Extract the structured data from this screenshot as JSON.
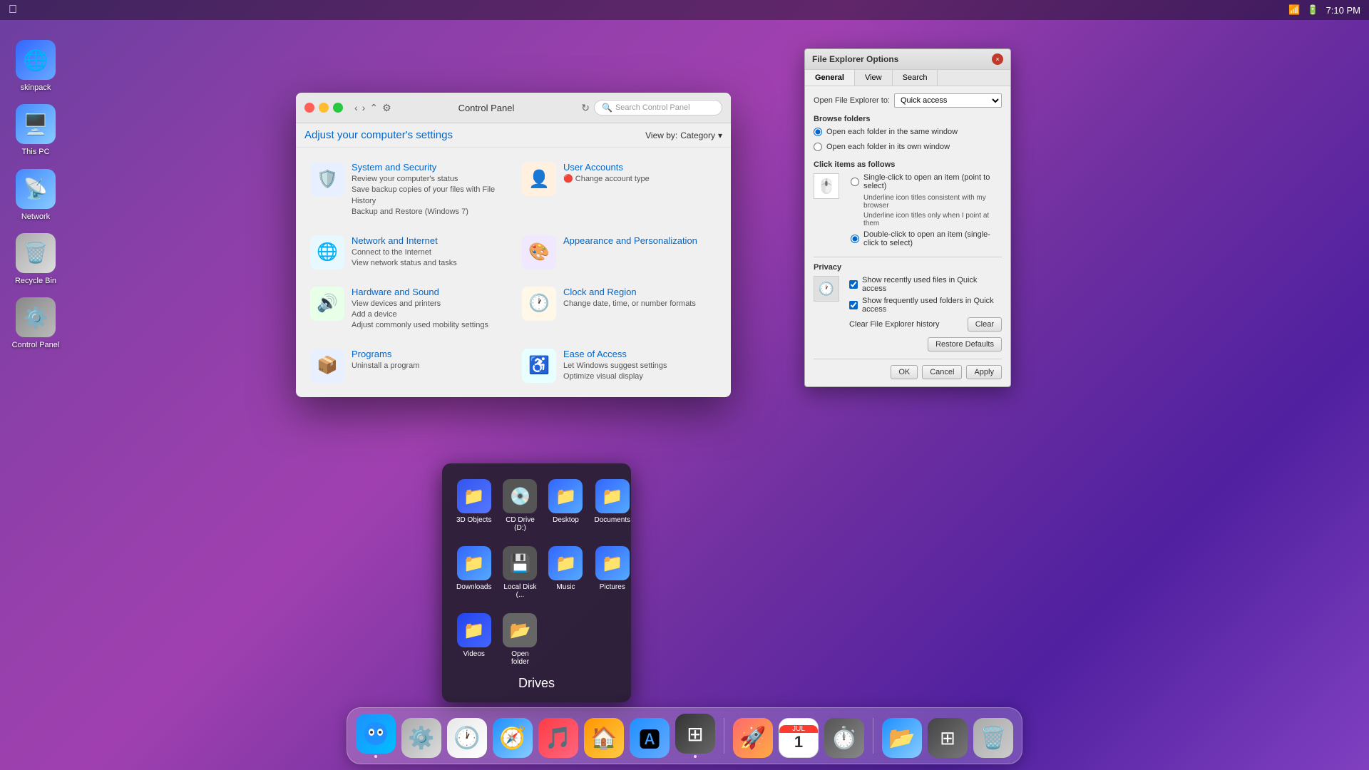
{
  "menubar": {
    "time": "7:10 PM",
    "wifi_icon": "📶",
    "battery_icon": "🔋"
  },
  "desktop": {
    "icons": [
      {
        "id": "skinpack",
        "label": "skinpack",
        "emoji": "🌐",
        "color": "#4488ff"
      },
      {
        "id": "this-pc",
        "label": "This PC",
        "emoji": "🖥️",
        "color": "#5599ff"
      },
      {
        "id": "network",
        "label": "Network",
        "emoji": "📡",
        "color": "#4488ff"
      },
      {
        "id": "recycle-bin",
        "label": "Recycle Bin",
        "emoji": "🗑️",
        "color": "#888"
      },
      {
        "id": "control-panel",
        "label": "Control Panel",
        "emoji": "⚙️",
        "color": "#888"
      }
    ]
  },
  "control_panel": {
    "title": "Control Panel",
    "heading": "Adjust your computer's settings",
    "view_by_label": "View by:",
    "view_by_value": "Category",
    "search_placeholder": "Search Control Panel",
    "items": [
      {
        "id": "system-security",
        "name": "System and Security",
        "description": "Review your computer's status\nSave backup copies of your files with File History\nBackup and Restore (Windows 7)",
        "emoji": "🛡️",
        "color": "#e8f0ff"
      },
      {
        "id": "user-accounts",
        "name": "User Accounts",
        "description": "Change account type",
        "emoji": "👤",
        "color": "#fff0e0"
      },
      {
        "id": "network-internet",
        "name": "Network and Internet",
        "description": "Connect to the Internet\nView network status and tasks",
        "emoji": "🌐",
        "color": "#e8f8ff"
      },
      {
        "id": "appearance-personalization",
        "name": "Appearance and Personalization",
        "description": "",
        "emoji": "🎨",
        "color": "#f0e8ff"
      },
      {
        "id": "hardware-sound",
        "name": "Hardware and Sound",
        "description": "View devices and printers\nAdd a device\nAdjust commonly used mobility settings",
        "emoji": "🔊",
        "color": "#e8ffe8"
      },
      {
        "id": "clock-region",
        "name": "Clock and Region",
        "description": "Change date, time, or number formats",
        "emoji": "🕐",
        "color": "#fff8e8"
      },
      {
        "id": "programs",
        "name": "Programs",
        "description": "Uninstall a program",
        "emoji": "📦",
        "color": "#e8f0ff"
      },
      {
        "id": "ease-access",
        "name": "Ease of Access",
        "description": "Let Windows suggest settings\nOptimize visual display",
        "emoji": "♿",
        "color": "#e8ffff"
      }
    ]
  },
  "feo_dialog": {
    "title": "File Explorer Options",
    "close_label": "×",
    "tabs": [
      "General",
      "View",
      "Search"
    ],
    "active_tab": "General",
    "open_label": "Open File Explorer to:",
    "open_value": "Quick access",
    "browse_folders_label": "Browse folders",
    "radio_same_window": "Open each folder in the same window",
    "radio_own_window": "Open each folder in its own window",
    "click_items_label": "Click items as follows",
    "radio_single_click": "Single-click to open an item (point to select)",
    "radio_single_underline_consistent": "Underline icon titles consistent with my browser",
    "radio_single_underline_hover": "Underline icon titles only when I point at them",
    "radio_double_click": "Double-click to open an item (single-click to select)",
    "privacy_label": "Privacy",
    "show_recent": "Show recently used files in Quick access",
    "show_frequent": "Show frequently used folders in Quick access",
    "clear_history_label": "Clear File Explorer history",
    "clear_btn": "Clear",
    "restore_defaults_btn": "Restore Defaults",
    "ok_btn": "OK",
    "cancel_btn": "Cancel",
    "apply_btn": "Apply"
  },
  "taskbar_popup": {
    "title": "Drives",
    "items": [
      {
        "id": "3d-objects",
        "label": "3D Objects",
        "emoji": "📁",
        "color": "#4466ff"
      },
      {
        "id": "cd-drive",
        "label": "CD Drive (D:)",
        "emoji": "💿",
        "color": "#888"
      },
      {
        "id": "desktop",
        "label": "Desktop",
        "emoji": "📁",
        "color": "#4488ff"
      },
      {
        "id": "documents",
        "label": "Documents",
        "emoji": "📁",
        "color": "#4488ff"
      },
      {
        "id": "downloads",
        "label": "Downloads",
        "emoji": "📁",
        "color": "#4488ff"
      },
      {
        "id": "local-disk",
        "label": "Local Disk (...",
        "emoji": "💾",
        "color": "#888"
      },
      {
        "id": "music",
        "label": "Music",
        "emoji": "📁",
        "color": "#4488ff"
      },
      {
        "id": "pictures",
        "label": "Pictures",
        "emoji": "📁",
        "color": "#4488ff"
      },
      {
        "id": "videos",
        "label": "Videos",
        "emoji": "📁",
        "color": "#4466ff"
      },
      {
        "id": "open-folder",
        "label": "Open folder",
        "emoji": "📂",
        "color": "#888"
      }
    ]
  },
  "dock": {
    "items": [
      {
        "id": "finder",
        "emoji": "🔵",
        "color": "#1e90ff",
        "has_dot": true
      },
      {
        "id": "system-prefs",
        "emoji": "⚙️",
        "color": "#888",
        "has_dot": false
      },
      {
        "id": "clock",
        "emoji": "🕐",
        "color": "#e8e8e8",
        "has_dot": false
      },
      {
        "id": "safari",
        "emoji": "🧭",
        "color": "#1e90ff",
        "has_dot": false
      },
      {
        "id": "itunes",
        "emoji": "🎵",
        "color": "#fc3c44",
        "has_dot": false
      },
      {
        "id": "homekit",
        "emoji": "🏠",
        "color": "#ff9500",
        "has_dot": false
      },
      {
        "id": "appstore",
        "emoji": "🅰️",
        "color": "#1e90ff",
        "has_dot": false
      },
      {
        "id": "boot-camp",
        "emoji": "⊞",
        "color": "#333",
        "has_dot": true
      },
      {
        "id": "launchpad",
        "emoji": "🚀",
        "color": "#ff6b6b",
        "has_dot": false
      },
      {
        "id": "calendar",
        "emoji": "📅",
        "color": "#ff3b30",
        "has_dot": false
      },
      {
        "id": "time-machine",
        "emoji": "⏱️",
        "color": "#555",
        "has_dot": false
      },
      {
        "id": "files",
        "emoji": "📂",
        "color": "#1e90ff",
        "has_dot": false
      },
      {
        "id": "mosaic",
        "emoji": "⊞",
        "color": "#555",
        "has_dot": false
      },
      {
        "id": "trash",
        "emoji": "🗑️",
        "color": "#888",
        "has_dot": false
      }
    ]
  }
}
